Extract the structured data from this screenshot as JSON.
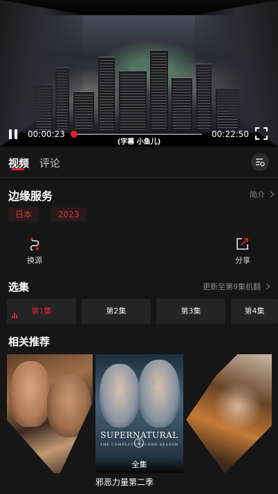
{
  "player": {
    "subtitle": "(字幕 小鱼儿)",
    "current_time": "00:00:23",
    "total_time": "00:22:50",
    "progress_fraction": 0.017
  },
  "tabs": [
    {
      "label": "视频",
      "active": true
    },
    {
      "label": "评论",
      "active": false
    }
  ],
  "show": {
    "title": "边缘服务",
    "intro_label": "简介",
    "tags": [
      "日本",
      "2023"
    ]
  },
  "actions": {
    "source_label": "换源",
    "share_label": "分享"
  },
  "episodes": {
    "section_title": "选集",
    "update_note": "更新至第9集机翻",
    "items": [
      "第1集",
      "第2集",
      "第3集",
      "第4集"
    ],
    "active_index": 0
  },
  "related": {
    "section_title": "相关推荐",
    "posters": [
      {
        "caption": ""
      },
      {
        "caption": "邪恶力量第二季",
        "badge": "全集",
        "logo": "SUPERNATURAL",
        "logo_sub": "THE COMPLETE  SECOND SEASON",
        "season_mark": "2"
      },
      {
        "caption": ""
      }
    ]
  },
  "colors": {
    "accent": "#e0232f",
    "background": "#161616",
    "card": "#242424"
  }
}
